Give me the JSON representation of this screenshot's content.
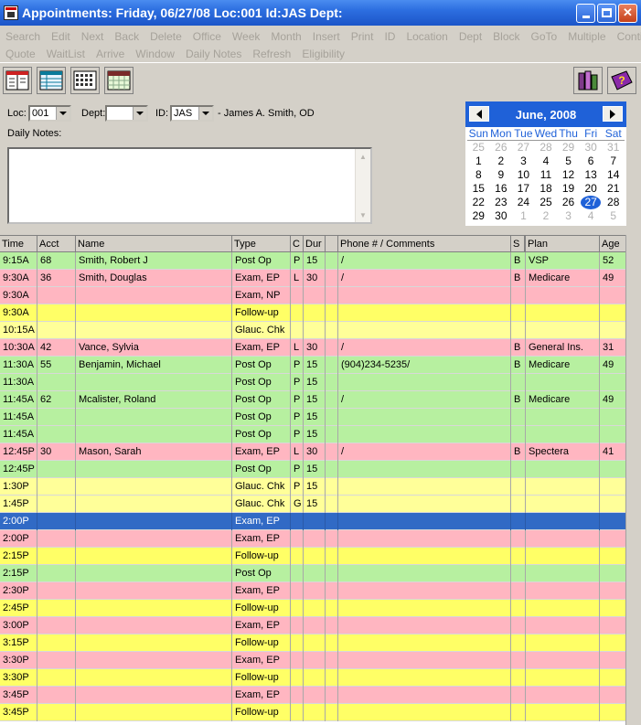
{
  "window": {
    "title": "Appointments: Friday, 06/27/08 Loc:001 Id:JAS Dept:"
  },
  "menu": {
    "row1": [
      "Search",
      "Edit",
      "Next",
      "Back",
      "Delete",
      "Office",
      "Week",
      "Month",
      "Insert",
      "Print",
      "ID",
      "Location",
      "Dept",
      "Block",
      "GoTo",
      "Multiple",
      "Continue"
    ],
    "row2": [
      "Quote",
      "WaitList",
      "Arrive",
      "Window",
      "Daily Notes",
      "Refresh",
      "Eligibility"
    ]
  },
  "toolbar": {
    "icons": [
      "day-view-icon",
      "list-view-icon",
      "month-view-icon",
      "calendar-view-icon",
      "books-icon",
      "help-book-icon"
    ]
  },
  "filters": {
    "loc_label": "Loc:",
    "loc_value": "001",
    "dept_label": "Dept:",
    "dept_value": "",
    "id_label": "ID:",
    "id_value": "JAS",
    "provider_name": "- James A. Smith, OD",
    "daily_notes_label": "Daily Notes:",
    "daily_notes_value": ""
  },
  "calendar": {
    "month_title": "June, 2008",
    "dows": [
      "Sun",
      "Mon",
      "Tue",
      "Wed",
      "Thu",
      "Fri",
      "Sat"
    ],
    "days": [
      {
        "d": "25",
        "o": true
      },
      {
        "d": "26",
        "o": true
      },
      {
        "d": "27",
        "o": true
      },
      {
        "d": "28",
        "o": true
      },
      {
        "d": "29",
        "o": true
      },
      {
        "d": "30",
        "o": true
      },
      {
        "d": "31",
        "o": true
      },
      {
        "d": "1"
      },
      {
        "d": "2"
      },
      {
        "d": "3"
      },
      {
        "d": "4"
      },
      {
        "d": "5"
      },
      {
        "d": "6"
      },
      {
        "d": "7"
      },
      {
        "d": "8"
      },
      {
        "d": "9"
      },
      {
        "d": "10"
      },
      {
        "d": "11"
      },
      {
        "d": "12"
      },
      {
        "d": "13"
      },
      {
        "d": "14"
      },
      {
        "d": "15"
      },
      {
        "d": "16"
      },
      {
        "d": "17"
      },
      {
        "d": "18"
      },
      {
        "d": "19"
      },
      {
        "d": "20"
      },
      {
        "d": "21"
      },
      {
        "d": "22"
      },
      {
        "d": "23"
      },
      {
        "d": "24"
      },
      {
        "d": "25"
      },
      {
        "d": "26"
      },
      {
        "d": "27",
        "sel": true
      },
      {
        "d": "28"
      },
      {
        "d": "29"
      },
      {
        "d": "30"
      },
      {
        "d": "1",
        "o": true
      },
      {
        "d": "2",
        "o": true
      },
      {
        "d": "3",
        "o": true
      },
      {
        "d": "4",
        "o": true
      },
      {
        "d": "5",
        "o": true
      }
    ]
  },
  "colors": {
    "green": "#b7f0a0",
    "pink": "#ffb6c1",
    "yellow": "#ffff66",
    "yellow_light": "#ffff99",
    "selected": "#316ac5"
  },
  "grid": {
    "headers": {
      "time": "Time",
      "acct": "Acct",
      "name": "Name",
      "type": "Type",
      "c": "C",
      "dur": "Dur",
      "x": "",
      "phone": "Phone # / Comments",
      "s": "S",
      "plan": "Plan",
      "age": "Age"
    },
    "rows": [
      {
        "time": "9:15A",
        "acct": "68",
        "name": "Smith, Robert J",
        "type": "Post Op",
        "c": "P",
        "dur": "15",
        "phone": "/",
        "s": "B",
        "plan": "VSP",
        "age": "52",
        "color": "green"
      },
      {
        "time": "9:30A",
        "acct": "36",
        "name": "Smith, Douglas",
        "type": "Exam, EP",
        "c": "L",
        "dur": "30",
        "phone": "/",
        "s": "B",
        "plan": "Medicare",
        "age": "49",
        "color": "pink"
      },
      {
        "time": "9:30A",
        "acct": "",
        "name": "",
        "type": "Exam, NP",
        "c": "",
        "dur": "",
        "phone": "",
        "s": "",
        "plan": "",
        "age": "",
        "color": "pink"
      },
      {
        "time": "9:30A",
        "acct": "",
        "name": "",
        "type": "Follow-up",
        "c": "",
        "dur": "",
        "phone": "",
        "s": "",
        "plan": "",
        "age": "",
        "color": "yellow"
      },
      {
        "time": "10:15A",
        "acct": "",
        "name": "",
        "type": "Glauc. Chk",
        "c": "",
        "dur": "",
        "phone": "",
        "s": "",
        "plan": "",
        "age": "",
        "color": "yellow_light"
      },
      {
        "time": "10:30A",
        "acct": "42",
        "name": "Vance, Sylvia",
        "type": "Exam, EP",
        "c": "L",
        "dur": "30",
        "phone": "/",
        "s": "B",
        "plan": "General Ins.",
        "age": "31",
        "color": "pink"
      },
      {
        "time": "11:30A",
        "acct": "55",
        "name": "Benjamin, Michael",
        "type": "Post Op",
        "c": "P",
        "dur": "15",
        "phone": "(904)234-5235/",
        "s": "B",
        "plan": "Medicare",
        "age": "49",
        "color": "green"
      },
      {
        "time": "11:30A",
        "acct": "",
        "name": "",
        "type": "Post Op",
        "c": "P",
        "dur": "15",
        "phone": "",
        "s": "",
        "plan": "",
        "age": "",
        "color": "green"
      },
      {
        "time": "11:45A",
        "acct": "62",
        "name": "Mcalister, Roland",
        "type": "Post Op",
        "c": "P",
        "dur": "15",
        "phone": "/",
        "s": "B",
        "plan": "Medicare",
        "age": "49",
        "color": "green"
      },
      {
        "time": "11:45A",
        "acct": "",
        "name": "",
        "type": "Post Op",
        "c": "P",
        "dur": "15",
        "phone": "",
        "s": "",
        "plan": "",
        "age": "",
        "color": "green"
      },
      {
        "time": "11:45A",
        "acct": "",
        "name": "",
        "type": "Post Op",
        "c": "P",
        "dur": "15",
        "phone": "",
        "s": "",
        "plan": "",
        "age": "",
        "color": "green"
      },
      {
        "time": "12:45P",
        "acct": "30",
        "name": "Mason, Sarah",
        "type": "Exam, EP",
        "c": "L",
        "dur": "30",
        "phone": "/",
        "s": "B",
        "plan": "Spectera",
        "age": "41",
        "color": "pink"
      },
      {
        "time": "12:45P",
        "acct": "",
        "name": "",
        "type": "Post Op",
        "c": "P",
        "dur": "15",
        "phone": "",
        "s": "",
        "plan": "",
        "age": "",
        "color": "green"
      },
      {
        "time": "1:30P",
        "acct": "",
        "name": "",
        "type": "Glauc. Chk",
        "c": "P",
        "dur": "15",
        "phone": "",
        "s": "",
        "plan": "",
        "age": "",
        "color": "yellow_light"
      },
      {
        "time": "1:45P",
        "acct": "",
        "name": "",
        "type": "Glauc. Chk",
        "c": "G",
        "dur": "15",
        "phone": "",
        "s": "",
        "plan": "",
        "age": "",
        "color": "yellow_light"
      },
      {
        "time": "2:00P",
        "acct": "",
        "name": "",
        "type": "Exam, EP",
        "c": "",
        "dur": "",
        "phone": "",
        "s": "",
        "plan": "",
        "age": "",
        "color": "selected"
      },
      {
        "time": "2:00P",
        "acct": "",
        "name": "",
        "type": "Exam, EP",
        "c": "",
        "dur": "",
        "phone": "",
        "s": "",
        "plan": "",
        "age": "",
        "color": "pink"
      },
      {
        "time": "2:15P",
        "acct": "",
        "name": "",
        "type": "Follow-up",
        "c": "",
        "dur": "",
        "phone": "",
        "s": "",
        "plan": "",
        "age": "",
        "color": "yellow"
      },
      {
        "time": "2:15P",
        "acct": "",
        "name": "",
        "type": "Post Op",
        "c": "",
        "dur": "",
        "phone": "",
        "s": "",
        "plan": "",
        "age": "",
        "color": "green"
      },
      {
        "time": "2:30P",
        "acct": "",
        "name": "",
        "type": "Exam, EP",
        "c": "",
        "dur": "",
        "phone": "",
        "s": "",
        "plan": "",
        "age": "",
        "color": "pink"
      },
      {
        "time": "2:45P",
        "acct": "",
        "name": "",
        "type": "Follow-up",
        "c": "",
        "dur": "",
        "phone": "",
        "s": "",
        "plan": "",
        "age": "",
        "color": "yellow"
      },
      {
        "time": "3:00P",
        "acct": "",
        "name": "",
        "type": "Exam, EP",
        "c": "",
        "dur": "",
        "phone": "",
        "s": "",
        "plan": "",
        "age": "",
        "color": "pink"
      },
      {
        "time": "3:15P",
        "acct": "",
        "name": "",
        "type": "Follow-up",
        "c": "",
        "dur": "",
        "phone": "",
        "s": "",
        "plan": "",
        "age": "",
        "color": "yellow"
      },
      {
        "time": "3:30P",
        "acct": "",
        "name": "",
        "type": "Exam, EP",
        "c": "",
        "dur": "",
        "phone": "",
        "s": "",
        "plan": "",
        "age": "",
        "color": "pink"
      },
      {
        "time": "3:30P",
        "acct": "",
        "name": "",
        "type": "Follow-up",
        "c": "",
        "dur": "",
        "phone": "",
        "s": "",
        "plan": "",
        "age": "",
        "color": "yellow"
      },
      {
        "time": "3:45P",
        "acct": "",
        "name": "",
        "type": "Exam, EP",
        "c": "",
        "dur": "",
        "phone": "",
        "s": "",
        "plan": "",
        "age": "",
        "color": "pink"
      },
      {
        "time": "3:45P",
        "acct": "",
        "name": "",
        "type": "Follow-up",
        "c": "",
        "dur": "",
        "phone": "",
        "s": "",
        "plan": "",
        "age": "",
        "color": "yellow"
      }
    ]
  }
}
